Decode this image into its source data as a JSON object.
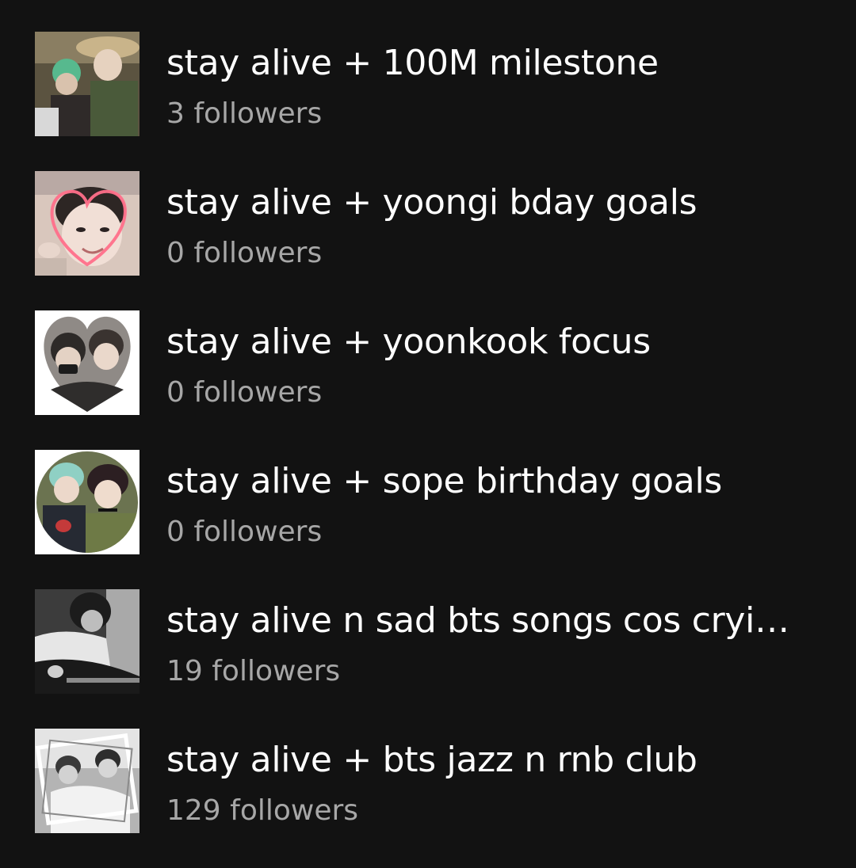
{
  "playlists": [
    {
      "title": "stay alive + 100M milestone",
      "followers": "3 followers",
      "cover_icon": "cover-image-icon"
    },
    {
      "title": "stay alive + yoongi bday goals",
      "followers": "0 followers",
      "cover_icon": "cover-image-icon"
    },
    {
      "title": "stay alive + yoonkook focus",
      "followers": "0 followers",
      "cover_icon": "cover-image-icon"
    },
    {
      "title": "stay alive + sope birthday goals",
      "followers": "0 followers",
      "cover_icon": "cover-image-icon"
    },
    {
      "title": "stay alive n sad bts songs cos cryi…",
      "followers": "19 followers",
      "cover_icon": "cover-image-icon"
    },
    {
      "title": "stay alive + bts jazz n rnb club",
      "followers": "129 followers",
      "cover_icon": "cover-image-icon"
    }
  ],
  "colors": {
    "background": "#121212",
    "title_text": "#ffffff",
    "subtitle_text": "#a7a7a7",
    "heart_outline": "#ff6f8a"
  }
}
